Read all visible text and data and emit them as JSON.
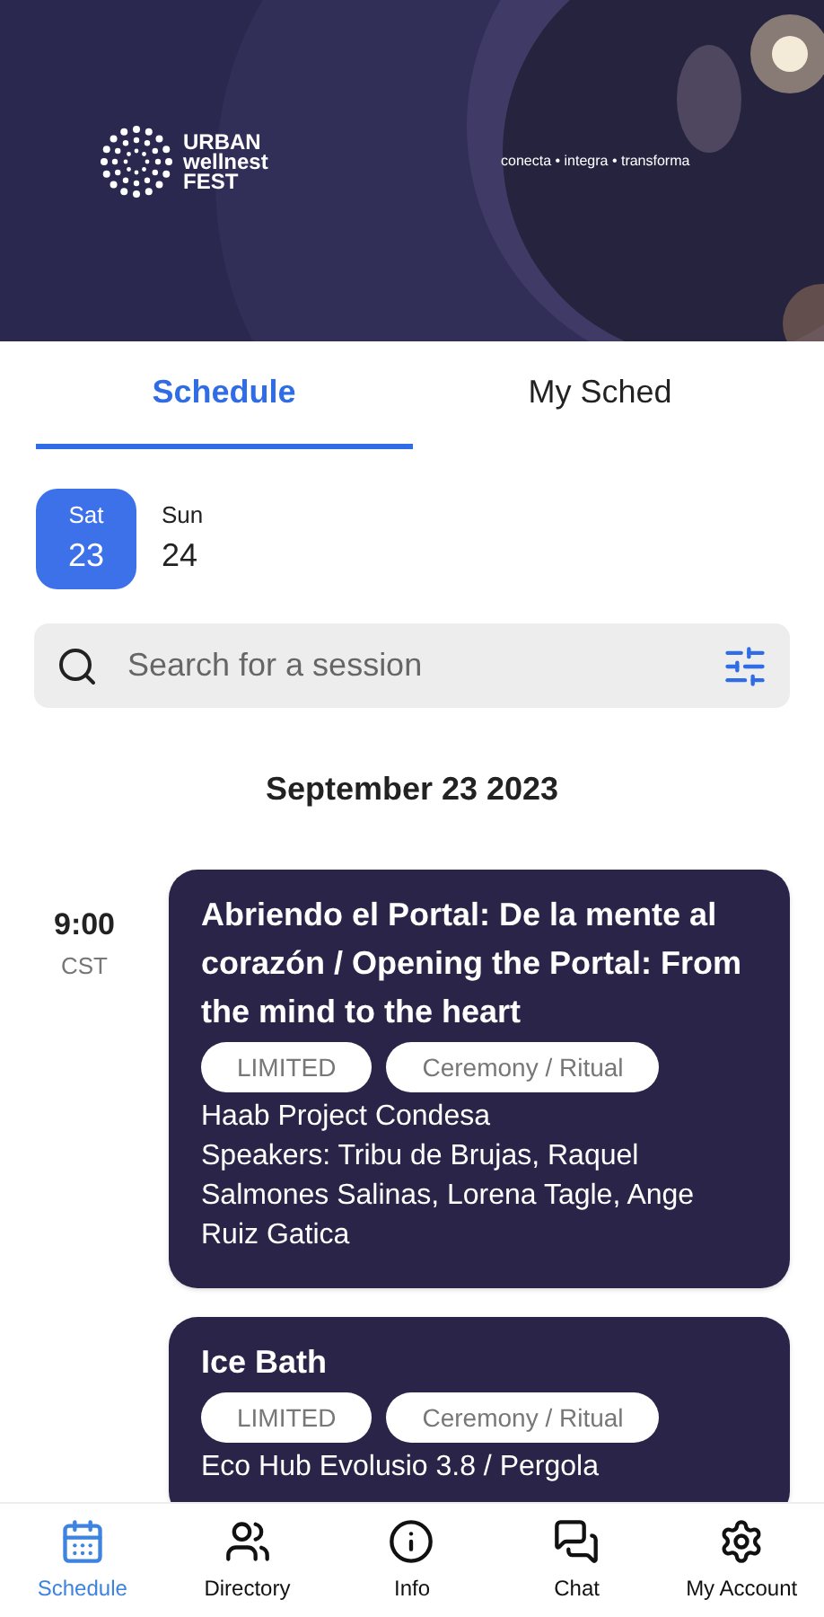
{
  "banner": {
    "logo_lines": [
      "URBAN",
      "wellnest",
      "FEST"
    ],
    "tagline": "conecta • integra • transforma"
  },
  "tabs": [
    {
      "label": "Schedule",
      "selected": true
    },
    {
      "label": "My Sched",
      "selected": false
    }
  ],
  "days": [
    {
      "weekday": "Sat",
      "day": "23",
      "selected": true
    },
    {
      "weekday": "Sun",
      "day": "24",
      "selected": false
    }
  ],
  "search": {
    "placeholder": "Search for a session"
  },
  "date_heading": "September 23 2023",
  "time_slots": [
    {
      "time": "9:00",
      "zone": "CST",
      "sessions": [
        {
          "title": "Abriendo el Portal: De la mente al corazón / Opening the Portal: From the mind to the heart",
          "tags": [
            "LIMITED",
            "Ceremony / Ritual"
          ],
          "lines": [
            "Haab Project Condesa",
            "Speakers: Tribu de Brujas, Raquel Salmones Salinas, Lorena Tagle, Ange Ruiz Gatica"
          ]
        },
        {
          "title": "Ice Bath",
          "tags": [
            "LIMITED",
            "Ceremony / Ritual"
          ],
          "lines": [
            "Eco Hub Evolusio 3.8 / Pergola"
          ]
        }
      ]
    }
  ],
  "bottom_nav": [
    {
      "label": "Schedule",
      "selected": true
    },
    {
      "label": "Directory",
      "selected": false
    },
    {
      "label": "Info",
      "selected": false
    },
    {
      "label": "Chat",
      "selected": false
    },
    {
      "label": "My Account",
      "selected": false
    }
  ]
}
